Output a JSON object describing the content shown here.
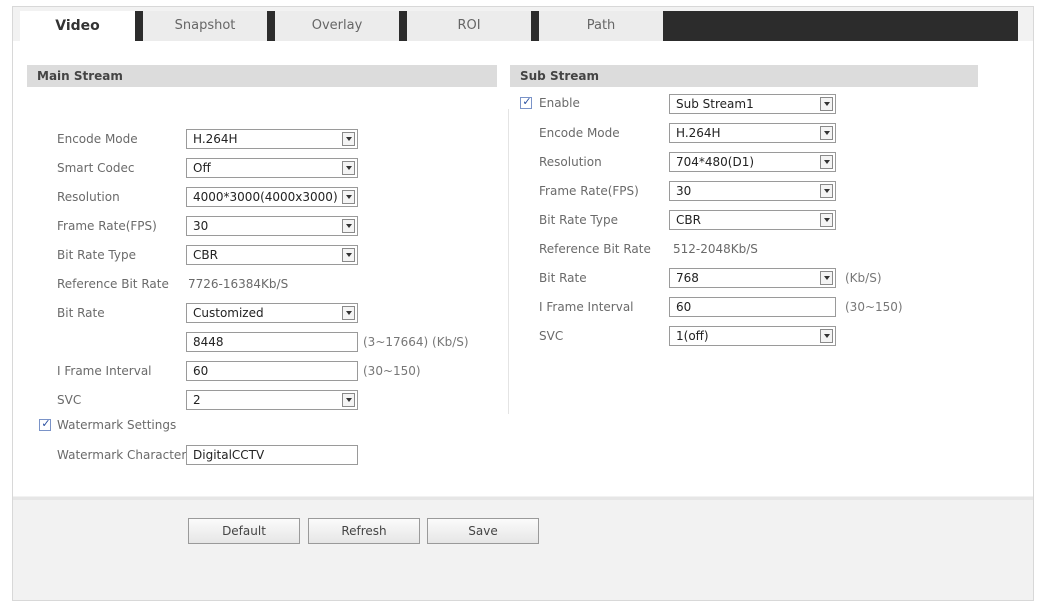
{
  "tabs": [
    "Video",
    "Snapshot",
    "Overlay",
    "ROI",
    "Path"
  ],
  "main_stream": {
    "title": "Main Stream",
    "encode_mode": {
      "label": "Encode Mode",
      "value": "H.264H"
    },
    "smart_codec": {
      "label": "Smart Codec",
      "value": "Off"
    },
    "resolution": {
      "label": "Resolution",
      "value": "4000*3000(4000x3000)"
    },
    "frame_rate": {
      "label": "Frame Rate(FPS)",
      "value": "30"
    },
    "bit_rate_type": {
      "label": "Bit Rate Type",
      "value": "CBR"
    },
    "reference_bit_rate": {
      "label": "Reference Bit Rate",
      "value": "7726-16384Kb/S"
    },
    "bit_rate": {
      "label": "Bit Rate",
      "value": "Customized",
      "custom_value": "8448",
      "hint": "(3~17664) (Kb/S)"
    },
    "i_frame_interval": {
      "label": "I Frame Interval",
      "value": "60",
      "hint": "(30~150)"
    },
    "svc": {
      "label": "SVC",
      "value": "2"
    },
    "watermark_settings": {
      "label": "Watermark Settings",
      "checked": true
    },
    "watermark_character": {
      "label": "Watermark Character",
      "value": "DigitalCCTV"
    }
  },
  "sub_stream": {
    "title": "Sub Stream",
    "enable": {
      "label": "Enable",
      "checked": true,
      "value": "Sub Stream1"
    },
    "encode_mode": {
      "label": "Encode Mode",
      "value": "H.264H"
    },
    "resolution": {
      "label": "Resolution",
      "value": "704*480(D1)"
    },
    "frame_rate": {
      "label": "Frame Rate(FPS)",
      "value": "30"
    },
    "bit_rate_type": {
      "label": "Bit Rate Type",
      "value": "CBR"
    },
    "reference_bit_rate": {
      "label": "Reference Bit Rate",
      "value": "512-2048Kb/S"
    },
    "bit_rate": {
      "label": "Bit Rate",
      "value": "768",
      "hint": "(Kb/S)"
    },
    "i_frame_interval": {
      "label": "I Frame Interval",
      "value": "60",
      "hint": "(30~150)"
    },
    "svc": {
      "label": "SVC",
      "value": "1(off)"
    }
  },
  "buttons": {
    "default": "Default",
    "refresh": "Refresh",
    "save": "Save"
  },
  "checkbox_mark": "✓"
}
